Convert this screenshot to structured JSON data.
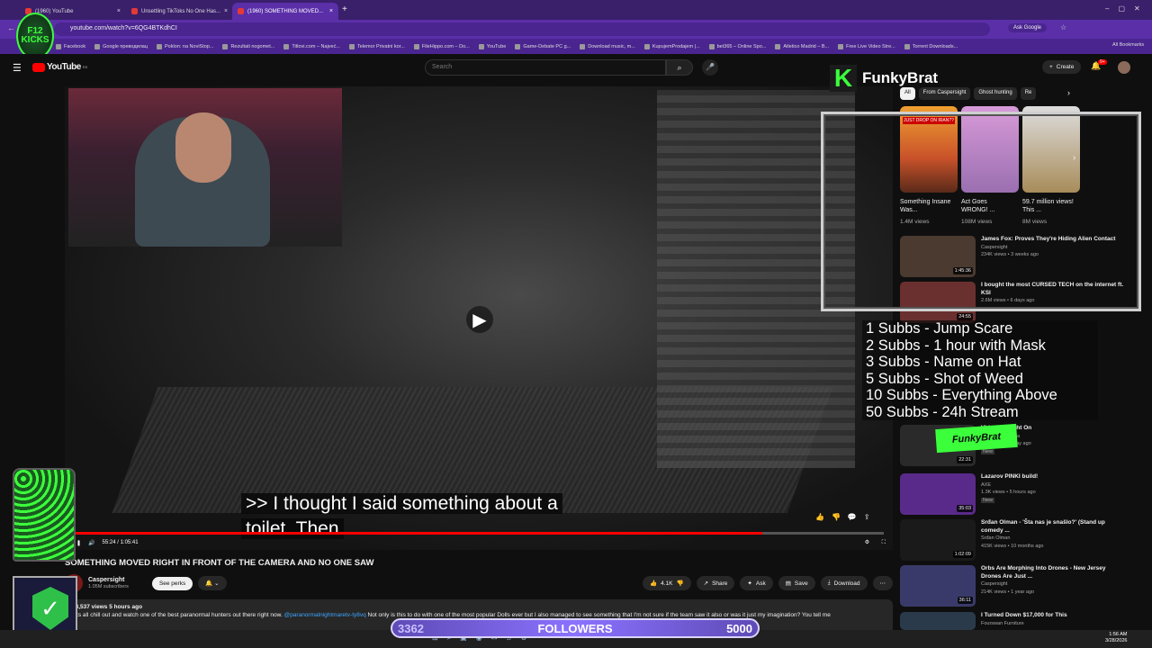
{
  "browser": {
    "tabs": [
      {
        "label": "(1960) YouTube"
      },
      {
        "label": "Unsettling TikToks No One Has..."
      },
      {
        "label": "(1960) SOMETHING MOVED..."
      }
    ],
    "new_tab_label": "+",
    "url": "youtube.com/watch?v=6QG4BTKdhCI",
    "ask_google": "Ask Google",
    "bookmarks": [
      "Facebook",
      "Google преводилац",
      "Poklon: na NoviStop...",
      "Rezultati nogomet...",
      "Titlovi.com – Najveć...",
      "Telemor Privatni kor...",
      "FileHippo.com – Do...",
      "YouTube",
      "Game-Debate PC g...",
      "Download music, m...",
      "KupujemProdajem |...",
      "bet365 – Online Spo...",
      "Atletico Madrid – B...",
      "Free Live Video Stre...",
      "Torrent Downloads..."
    ],
    "all_bookmarks": "All Bookmarks"
  },
  "youtube": {
    "logo": "YouTube",
    "region": "RS",
    "search_placeholder": "Search",
    "create_label": "Create",
    "notif_count": "9+"
  },
  "video": {
    "caption_line1": ">> I thought I said something about a",
    "caption_line2": "toilet. Then",
    "time": "55:24 / 1:05:41",
    "progress": 0.85,
    "title": "SOMETHING MOVED RIGHT IN FRONT OF THE CAMERA AND NO ONE SAW",
    "channel": "Caspersight",
    "subscribers": "1.05M subscribers",
    "see_perks": "See perks",
    "likes": "4.1K",
    "share": "Share",
    "ask": "Ask",
    "save": "Save",
    "download": "Download",
    "desc_stats": "13,537 views  5 hours ago",
    "desc_text": "lets all chill out and watch one of the best paranormal hunters out there right now.",
    "desc_link": "@paranormalnightmaretv-ty8vq",
    "desc_more": "Not only is this to do with one of the most popular Dolls ever but I also managed to see something that I'm not sure if the team saw it also or was it just my imagination? You tell me"
  },
  "overlay": {
    "brand": "FunkyBrat",
    "brand_k": "K",
    "badge": "F12 KICKS",
    "subbs": [
      "1 Subbs - Jump Scare",
      "2 Subbs - 1 hour with Mask",
      "3 Subbs - Name on Hat",
      "5 Subbs - Shot of Weed",
      "10 Subbs - Everything Above",
      "50 Subbs - 24h Stream"
    ],
    "followers_current": "3362",
    "followers_label": "FOLLOWERS",
    "followers_goal": "5000"
  },
  "chips": [
    "All",
    "From Caspersight",
    "Ghost hunting",
    "Re"
  ],
  "shorts": [
    {
      "title": "Something Insane Was...",
      "views": "1.4M views",
      "thumb": "#c9522a",
      "tag": "JUST DROP ON IRAN??"
    },
    {
      "title": "Act Goes WRONG! ...",
      "views": "108M views",
      "thumb": "#9a6fb0",
      "tag": ""
    },
    {
      "title": "59.7 million views! This ...",
      "views": "8M views",
      "thumb": "#a88c5a",
      "tag": ""
    }
  ],
  "recs": [
    {
      "title": "James Fox: Proves They're Hiding Alien Contact",
      "channel": "Caspersight",
      "meta": "234K views • 3 weeks ago",
      "dur": "1:45:36",
      "color": "#4a3a30"
    },
    {
      "title": "I bought the most CURSED TECH on the internet ft. KSI",
      "channel": "",
      "meta": "2.6M views • 6 days ago",
      "dur": "24:55",
      "color": "#6a3030"
    },
    {
      "title": "Videos Caught On",
      "channel": "of Horror America",
      "meta": "1.8K views • 1 day ago",
      "dur": "22:31",
      "color": "#2a2a2a",
      "badge": "New"
    },
    {
      "title": "Lazarov PINKI build!",
      "channel": "AXE",
      "meta": "1.3K views • 5 hours ago",
      "dur": "35:03",
      "color": "#5a2a8a",
      "badge": "New"
    },
    {
      "title": "Srđan Olman - 'Šta nas je snašlo?' (Stand up comedy ...",
      "channel": "Srđan Olman",
      "meta": "415K views • 10 months ago",
      "dur": "1:02:09",
      "color": "#1a1a1a"
    },
    {
      "title": "Orbs Are Morphing Into Drones - New Jersey Drones Are Just ...",
      "channel": "Caspersight",
      "meta": "214K views • 1 year ago",
      "dur": "36:11",
      "color": "#3a3a6a"
    },
    {
      "title": "I Turned Down $17,000 for This",
      "channel": "Fourswan Furniture",
      "meta": "",
      "dur": "",
      "color": "#2a3a4a"
    }
  ],
  "clock": {
    "time": "1:56 AM",
    "date": "3/28/2026"
  }
}
